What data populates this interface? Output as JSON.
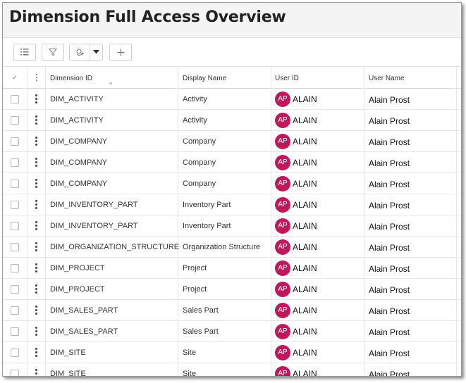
{
  "page": {
    "title": "Dimension Full Access Overview"
  },
  "toolbar": {
    "buttons": [
      "list-icon",
      "filter-icon",
      "group-icon",
      "chevron-down-icon",
      "plus-icon"
    ]
  },
  "columns": {
    "select": "✓",
    "dimension_id": "Dimension ID",
    "display_name": "Display Name",
    "user_id": "User ID",
    "user_name": "User Name",
    "sort_indicator": "^"
  },
  "colors": {
    "avatar": "#c2185b"
  },
  "rows": [
    {
      "dimension_id": "DIM_ACTIVITY",
      "display_name": "Activity",
      "avatar": "AP",
      "user_id": "ALAIN",
      "user_name": "Alain Prost"
    },
    {
      "dimension_id": "DIM_ACTIVITY",
      "display_name": "Activity",
      "avatar": "AP",
      "user_id": "ALAIN",
      "user_name": "Alain Prost"
    },
    {
      "dimension_id": "DIM_COMPANY",
      "display_name": "Company",
      "avatar": "AP",
      "user_id": "ALAIN",
      "user_name": "Alain Prost"
    },
    {
      "dimension_id": "DIM_COMPANY",
      "display_name": "Company",
      "avatar": "AP",
      "user_id": "ALAIN",
      "user_name": "Alain Prost"
    },
    {
      "dimension_id": "DIM_COMPANY",
      "display_name": "Company",
      "avatar": "AP",
      "user_id": "ALAIN",
      "user_name": "Alain Prost"
    },
    {
      "dimension_id": "DIM_INVENTORY_PART",
      "display_name": "Inventory Part",
      "avatar": "AP",
      "user_id": "ALAIN",
      "user_name": "Alain Prost"
    },
    {
      "dimension_id": "DIM_INVENTORY_PART",
      "display_name": "Inventory Part",
      "avatar": "AP",
      "user_id": "ALAIN",
      "user_name": "Alain Prost"
    },
    {
      "dimension_id": "DIM_ORGANIZATION_STRUCTURE",
      "display_name": "Organization Structure",
      "avatar": "AP",
      "user_id": "ALAIN",
      "user_name": "Alain Prost"
    },
    {
      "dimension_id": "DIM_PROJECT",
      "display_name": "Project",
      "avatar": "AP",
      "user_id": "ALAIN",
      "user_name": "Alain Prost"
    },
    {
      "dimension_id": "DIM_PROJECT",
      "display_name": "Project",
      "avatar": "AP",
      "user_id": "ALAIN",
      "user_name": "Alain Prost"
    },
    {
      "dimension_id": "DIM_SALES_PART",
      "display_name": "Sales Part",
      "avatar": "AP",
      "user_id": "ALAIN",
      "user_name": "Alain Prost"
    },
    {
      "dimension_id": "DIM_SALES_PART",
      "display_name": "Sales Part",
      "avatar": "AP",
      "user_id": "ALAIN",
      "user_name": "Alain Prost"
    },
    {
      "dimension_id": "DIM_SITE",
      "display_name": "Site",
      "avatar": "AP",
      "user_id": "ALAIN",
      "user_name": "Alain Prost"
    },
    {
      "dimension_id": "DIM_SITE",
      "display_name": "Site",
      "avatar": "AP",
      "user_id": "ALAIN",
      "user_name": "Alain Prost"
    }
  ]
}
